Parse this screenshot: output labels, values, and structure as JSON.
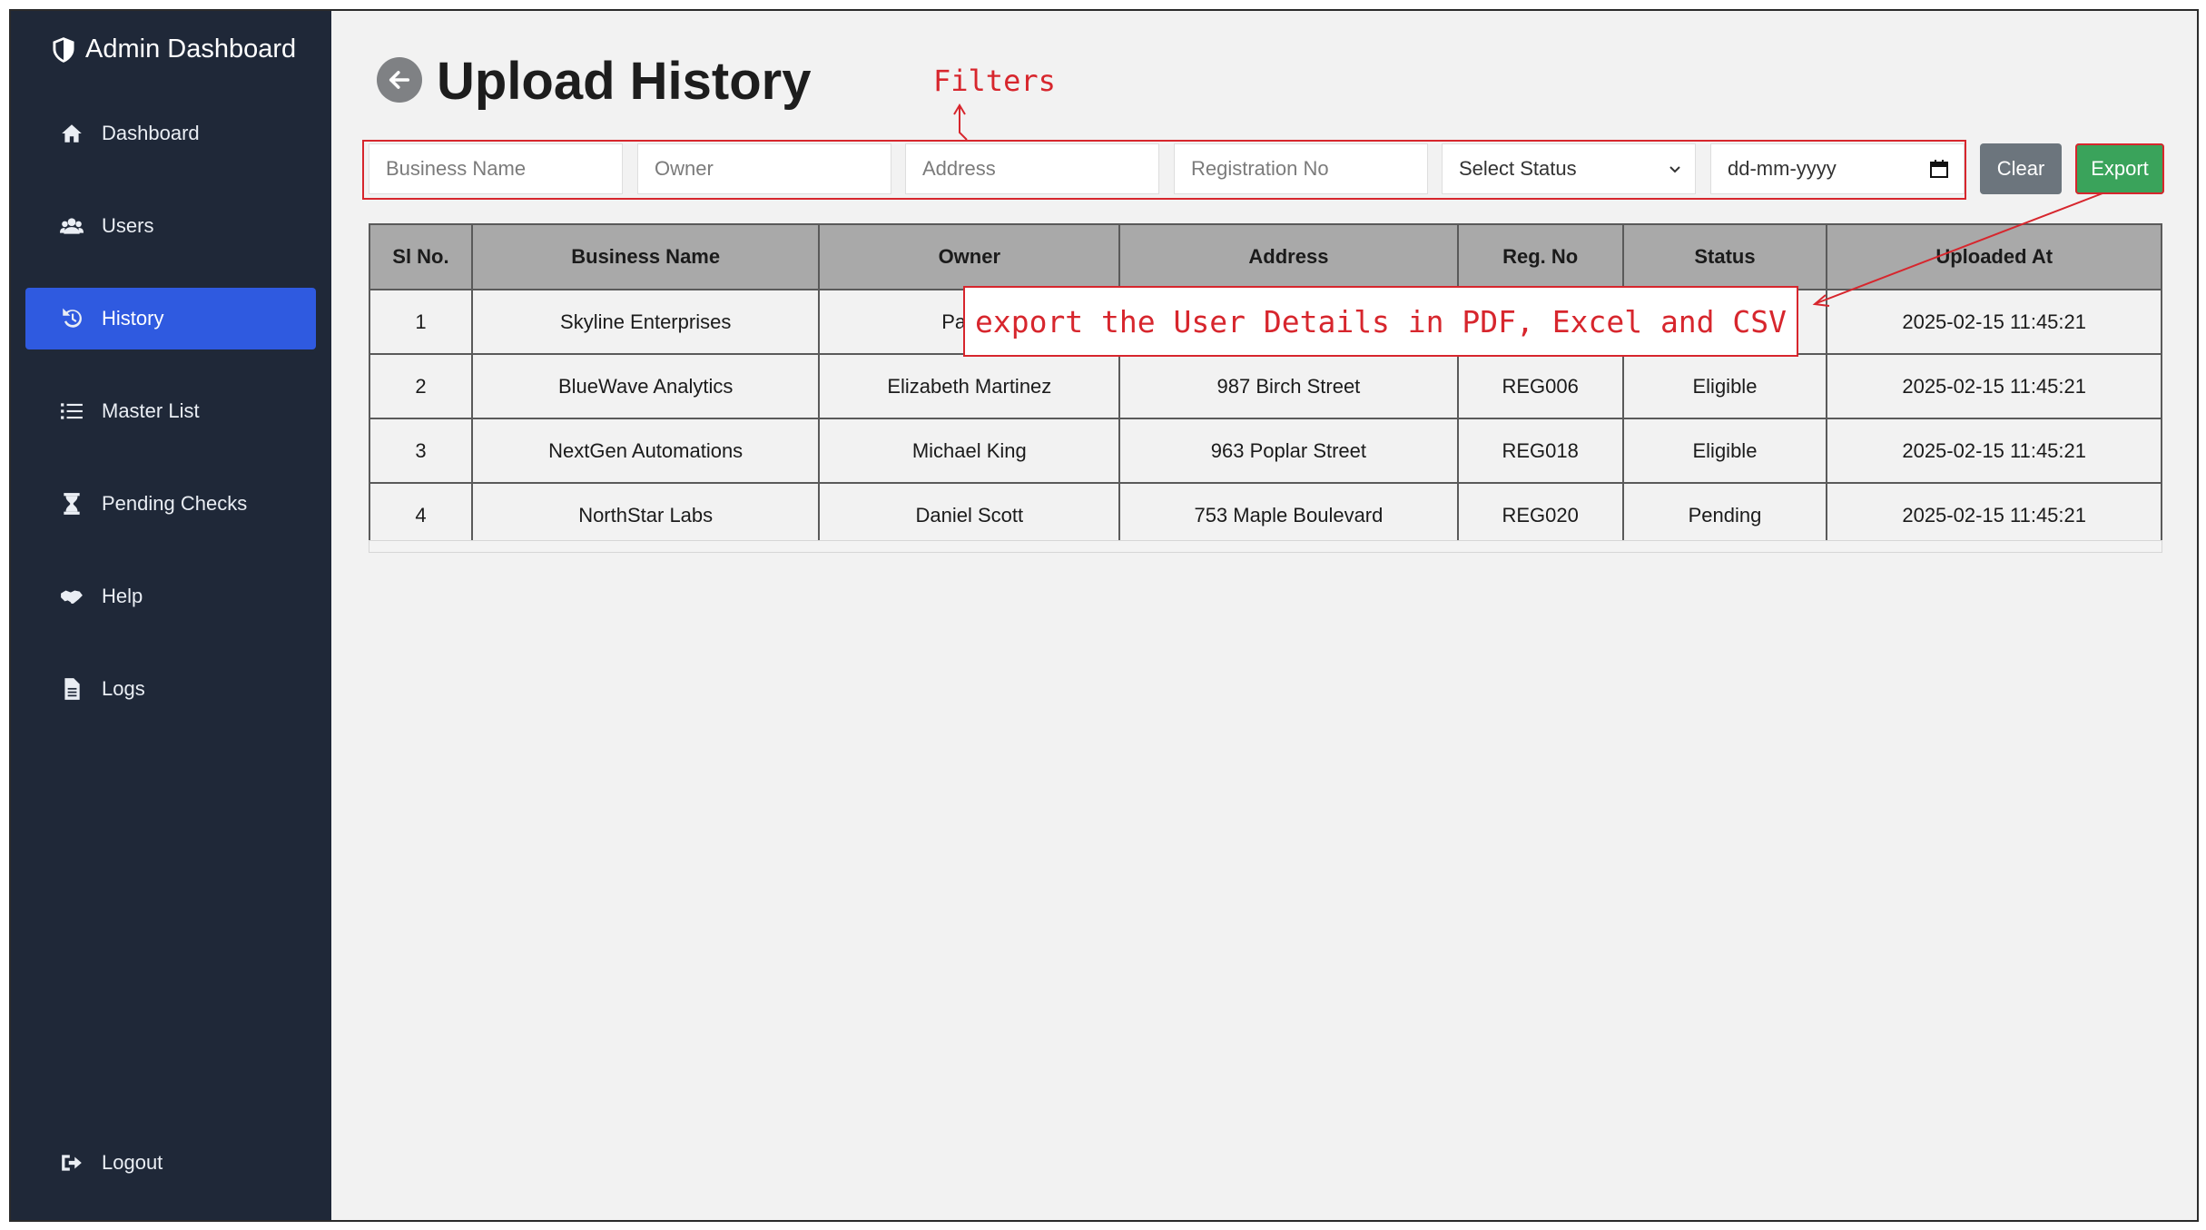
{
  "sidebar": {
    "brand": "Admin Dashboard",
    "items": [
      {
        "label": "Dashboard",
        "icon": "home-icon"
      },
      {
        "label": "Users",
        "icon": "users-icon"
      },
      {
        "label": "History",
        "icon": "history-icon",
        "active": true
      },
      {
        "label": "Master List",
        "icon": "list-icon"
      },
      {
        "label": "Pending Checks",
        "icon": "hourglass-icon"
      },
      {
        "label": "Help",
        "icon": "handshake-icon"
      },
      {
        "label": "Logs",
        "icon": "file-icon"
      }
    ],
    "logout": "Logout"
  },
  "header": {
    "title": "Upload History"
  },
  "filters": {
    "business_name_placeholder": "Business Name",
    "owner_placeholder": "Owner",
    "address_placeholder": "Address",
    "registration_placeholder": "Registration No",
    "status_selected": "Select Status",
    "date_placeholder": "dd-mm-yyyy",
    "clear_label": "Clear",
    "export_label": "Export"
  },
  "table": {
    "columns": [
      "Sl No.",
      "Business Name",
      "Owner",
      "Address",
      "Reg. No",
      "Status",
      "Uploaded At"
    ],
    "rows": [
      [
        "1",
        "Skyline Enterprises",
        "Patrici",
        "",
        "",
        "",
        "2025-02-15 11:45:21"
      ],
      [
        "2",
        "BlueWave Analytics",
        "Elizabeth Martinez",
        "987 Birch Street",
        "REG006",
        "Eligible",
        "2025-02-15 11:45:21"
      ],
      [
        "3",
        "NextGen Automations",
        "Michael King",
        "963 Poplar Street",
        "REG018",
        "Eligible",
        "2025-02-15 11:45:21"
      ],
      [
        "4",
        "NorthStar Labs",
        "Daniel Scott",
        "753 Maple Boulevard",
        "REG020",
        "Pending",
        "2025-02-15 11:45:21"
      ]
    ]
  },
  "annotations": {
    "filters": "Filters",
    "export_note": "export the User Details in PDF, Excel and CSV"
  },
  "colors": {
    "sidebar_bg": "#1f2838",
    "active_nav": "#2f5ae0",
    "export_button": "#3aa35b",
    "clear_button": "#6c757d",
    "annotation_red": "#d7262d",
    "table_header": "#a9a9a9"
  }
}
